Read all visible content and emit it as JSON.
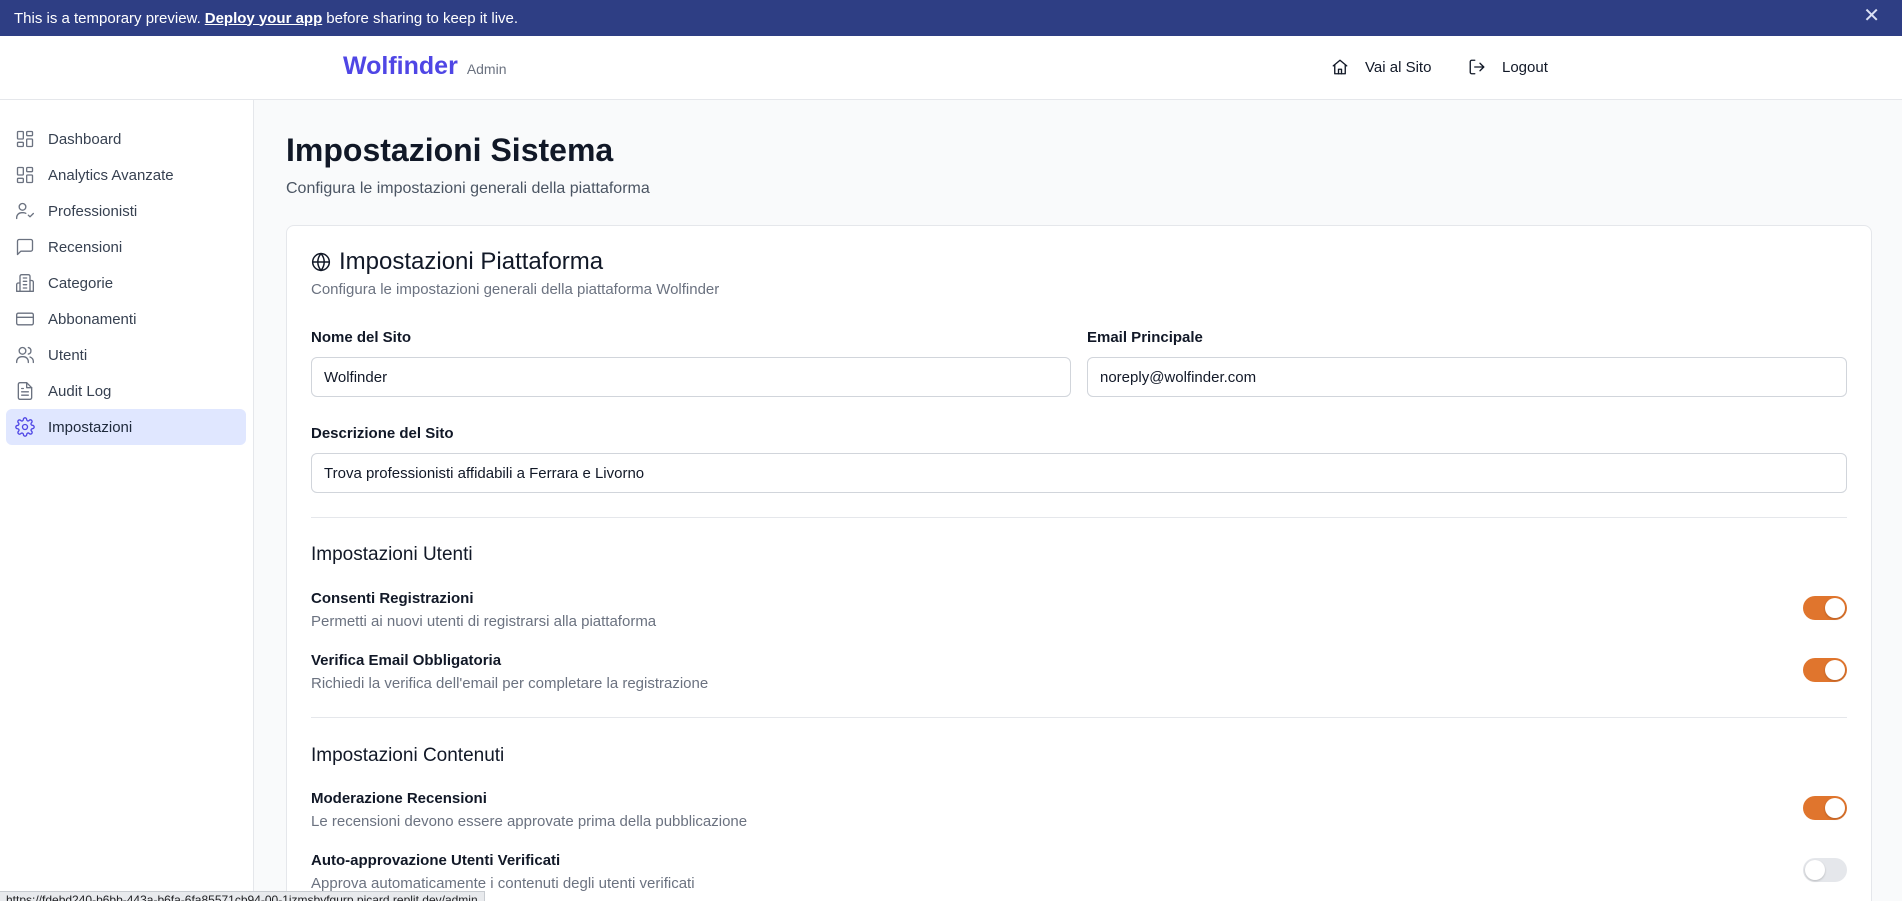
{
  "banner": {
    "text_before": "This is a temporary preview.",
    "link_label": "Deploy your app",
    "text_after": "before sharing to keep it live.",
    "close_glyph": "✕"
  },
  "header": {
    "brand": "Wolfinder",
    "role": "Admin",
    "site_link": "Vai al Sito",
    "logout": "Logout"
  },
  "sidebar": {
    "items": [
      {
        "label": "Dashboard",
        "icon": "grid-icon"
      },
      {
        "label": "Analytics Avanzate",
        "icon": "grid-icon"
      },
      {
        "label": "Professionisti",
        "icon": "user-check-icon"
      },
      {
        "label": "Recensioni",
        "icon": "message-icon"
      },
      {
        "label": "Categorie",
        "icon": "building-icon"
      },
      {
        "label": "Abbonamenti",
        "icon": "credit-card-icon"
      },
      {
        "label": "Utenti",
        "icon": "users-icon"
      },
      {
        "label": "Audit Log",
        "icon": "file-icon"
      },
      {
        "label": "Impostazioni",
        "icon": "gear-icon",
        "active": true
      }
    ]
  },
  "page": {
    "title": "Impostazioni Sistema",
    "subtitle": "Configura le impostazioni generali della piattaforma"
  },
  "card": {
    "title": "Impostazioni Piattaforma",
    "subtitle": "Configura le impostazioni generali della piattaforma Wolfinder",
    "site_name_label": "Nome del Sito",
    "site_name_value": "Wolfinder",
    "email_label": "Email Principale",
    "email_value": "noreply@wolfinder.com",
    "description_label": "Descrizione del Sito",
    "description_value": "Trova professionisti affidabili a Ferrara e Livorno"
  },
  "users_section": {
    "title": "Impostazioni Utenti",
    "options": [
      {
        "label": "Consenti Registrazioni",
        "desc": "Permetti ai nuovi utenti di registrarsi alla piattaforma",
        "enabled": true
      },
      {
        "label": "Verifica Email Obbligatoria",
        "desc": "Richiedi la verifica dell'email per completare la registrazione",
        "enabled": true
      }
    ]
  },
  "content_section": {
    "title": "Impostazioni Contenuti",
    "options": [
      {
        "label": "Moderazione Recensioni",
        "desc": "Le recensioni devono essere approvate prima della pubblicazione",
        "enabled": true
      },
      {
        "label": "Auto-approvazione Utenti Verificati",
        "desc": "Approva automaticamente i contenuti degli utenti verificati",
        "enabled": false
      }
    ]
  },
  "colors": {
    "brand": "#4f46e5",
    "toggle_on": "#e0752d",
    "banner": "#2e3e84"
  },
  "status_bar": {
    "url": "https://fdebd240-b6bb-443a-b6fa-6fa85571cb94-00-1jzmsbyfgurp.picard.replit.dev/admin"
  }
}
